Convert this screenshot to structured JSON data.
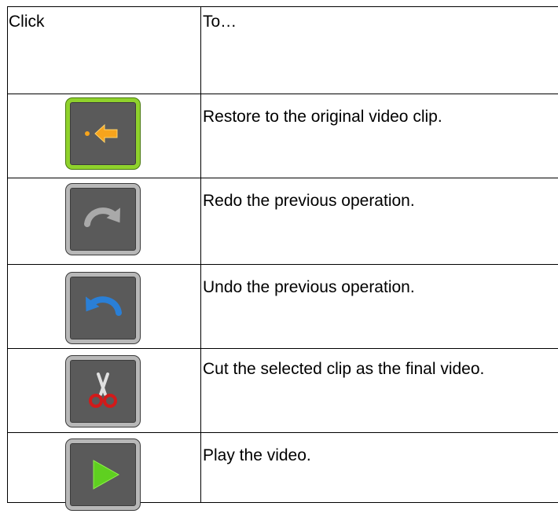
{
  "table": {
    "header": {
      "click": "Click",
      "to": "To…"
    },
    "rows": [
      {
        "icon": "restore-arrow-icon",
        "text": "Restore to the original video clip."
      },
      {
        "icon": "redo-icon",
        "text": "Redo the previous operation."
      },
      {
        "icon": "undo-icon",
        "text": "Undo the previous operation."
      },
      {
        "icon": "scissors-icon",
        "text": "Cut the selected clip as the final video."
      },
      {
        "icon": "play-icon",
        "text": "Play the video."
      }
    ]
  },
  "colors": {
    "button_bg": "#5a5a5a",
    "button_border": "#b8b8b8",
    "active_border": "#8fd22c",
    "restore_arrow": "#f7a41c",
    "undo_blue": "#2a7fd6",
    "scissors_red": "#d21a1a",
    "play_green": "#5fd020"
  }
}
